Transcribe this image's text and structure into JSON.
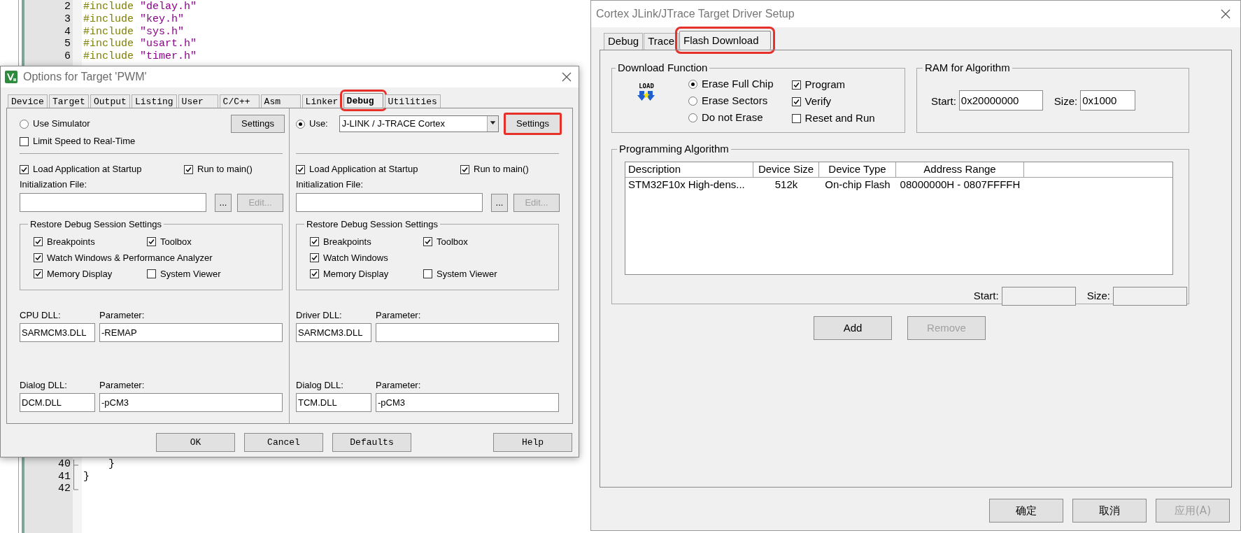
{
  "editor": {
    "top_lines": [
      {
        "number": "2",
        "kind": "include",
        "directive": "#include",
        "file": "\"delay.h\""
      },
      {
        "number": "3",
        "kind": "include",
        "directive": "#include",
        "file": "\"key.h\""
      },
      {
        "number": "4",
        "kind": "include",
        "directive": "#include",
        "file": "\"sys.h\""
      },
      {
        "number": "5",
        "kind": "include",
        "directive": "#include",
        "file": "\"usart.h\""
      },
      {
        "number": "6",
        "kind": "include",
        "directive": "#include",
        "file": "\"timer.h\""
      }
    ],
    "bottom_lines": [
      {
        "number": "40",
        "kind": "brace",
        "text": "    }"
      },
      {
        "number": "41",
        "kind": "brace",
        "text": "}"
      },
      {
        "number": "42",
        "kind": "blank"
      }
    ]
  },
  "options_dialog": {
    "title": "Options for Target 'PWM'",
    "tabs": [
      {
        "label": "Device",
        "selected": false,
        "highlighted": false
      },
      {
        "label": "Target",
        "selected": false,
        "highlighted": false
      },
      {
        "label": "Output",
        "selected": false,
        "highlighted": false
      },
      {
        "label": "Listing",
        "selected": false,
        "highlighted": false
      },
      {
        "label": "User",
        "selected": false,
        "highlighted": false
      },
      {
        "label": "C/C++",
        "selected": false,
        "highlighted": false
      },
      {
        "label": "Asm",
        "selected": false,
        "highlighted": false
      },
      {
        "label": "Linker",
        "selected": false,
        "highlighted": false
      },
      {
        "label": "Debug",
        "selected": true,
        "highlighted": true
      },
      {
        "label": "Utilities",
        "selected": false,
        "highlighted": false
      }
    ],
    "panes": [
      {
        "kind": "simulator",
        "use": {
          "label": "Use Simulator",
          "selected": false
        },
        "settings": {
          "label": "Settings",
          "highlighted": false
        },
        "limit_speed": {
          "label": "Limit Speed to Real-Time",
          "checked": false
        },
        "load_application": {
          "label": "Load Application at Startup",
          "checked": true
        },
        "run_to_main": {
          "label": "Run to main()",
          "checked": true
        },
        "init_file_label": "Initialization File:",
        "browse_button": "...",
        "edit_button": {
          "label": "Edit...",
          "disabled": true
        },
        "restore_title": "Restore Debug Session Settings",
        "restore_rows": [
          [
            {
              "label": "Breakpoints",
              "checked": true
            },
            {
              "label": "Toolbox",
              "checked": true
            }
          ],
          [
            {
              "label": "Watch Windows & Performance Analyzer",
              "checked": true
            }
          ],
          [
            {
              "label": "Memory Display",
              "checked": true
            },
            {
              "label": "System Viewer",
              "checked": false
            }
          ]
        ],
        "dll_label": "CPU DLL:",
        "dll_value": "SARMCM3.DLL",
        "dll_param_label": "Parameter:",
        "dll_param_value": "-REMAP",
        "dialog_dll_label": "Dialog DLL:",
        "dialog_dll_value": "DCM.DLL",
        "dialog_param_label": "Parameter:",
        "dialog_param_value": "-pCM3"
      },
      {
        "kind": "target",
        "use": {
          "label": "Use:",
          "selected": true
        },
        "driver": "J-LINK / J-TRACE Cortex",
        "settings": {
          "label": "Settings",
          "highlighted": true
        },
        "load_application": {
          "label": "Load Application at Startup",
          "checked": true
        },
        "run_to_main": {
          "label": "Run to main()",
          "checked": true
        },
        "init_file_label": "Initialization File:",
        "browse_button": "...",
        "edit_button": {
          "label": "Edit...",
          "disabled": true
        },
        "restore_title": "Restore Debug Session Settings",
        "restore_rows": [
          [
            {
              "label": "Breakpoints",
              "checked": true
            },
            {
              "label": "Toolbox",
              "checked": true
            }
          ],
          [
            {
              "label": "Watch Windows",
              "checked": true
            }
          ],
          [
            {
              "label": "Memory Display",
              "checked": true
            },
            {
              "label": "System Viewer",
              "checked": false
            }
          ]
        ],
        "dll_label": "Driver DLL:",
        "dll_value": "SARMCM3.DLL",
        "dll_param_label": "Parameter:",
        "dialog_dll_label": "Dialog DLL:",
        "dialog_dll_value": "TCM.DLL",
        "dialog_param_label": "Parameter:",
        "dialog_param_value": "-pCM3"
      }
    ],
    "buttons": [
      {
        "label": "OK"
      },
      {
        "label": "Cancel"
      },
      {
        "label": "Defaults"
      },
      {
        "label": "Help"
      }
    ]
  },
  "driver_setup": {
    "title": "Cortex JLink/JTrace Target Driver Setup",
    "tabs": [
      {
        "label": "Debug",
        "selected": false,
        "highlighted": false
      },
      {
        "label": "Trace",
        "selected": false,
        "highlighted": false
      },
      {
        "label": "Flash Download",
        "selected": true,
        "highlighted": true
      }
    ],
    "download_function": {
      "title": "Download Function",
      "icon_label": "LOAD",
      "erase_options": [
        {
          "label": "Erase Full Chip",
          "selected": true
        },
        {
          "label": "Erase Sectors",
          "selected": false
        },
        {
          "label": "Do not Erase",
          "selected": false
        }
      ],
      "options": [
        {
          "label": "Program",
          "checked": true
        },
        {
          "label": "Verify",
          "checked": true
        },
        {
          "label": "Reset and Run",
          "checked": false
        }
      ]
    },
    "ram": {
      "title": "RAM for Algorithm",
      "start_label": "Start:",
      "start_value": "0x20000000",
      "size_label": "Size:",
      "size_value": "0x1000"
    },
    "algorithm": {
      "title": "Programming Algorithm",
      "columns": [
        "Description",
        "Device Size",
        "Device Type",
        "Address Range"
      ],
      "rows": [
        [
          "STM32F10x High-dens...",
          "512k",
          "On-chip Flash",
          "08000000H - 0807FFFFH"
        ]
      ],
      "start_label": "Start:",
      "size_label": "Size:"
    },
    "buttons": [
      {
        "label": "Add",
        "disabled": false
      },
      {
        "label": "Remove",
        "disabled": true
      }
    ],
    "footer_buttons": [
      {
        "label": "确定",
        "disabled": false
      },
      {
        "label": "取消",
        "disabled": false
      },
      {
        "label": "应用(A)",
        "disabled": true
      }
    ]
  }
}
